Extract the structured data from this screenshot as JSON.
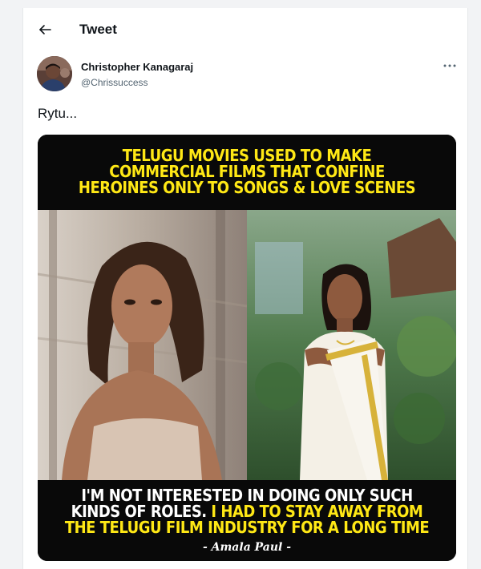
{
  "header": {
    "title": "Tweet"
  },
  "author": {
    "name": "Christopher Kanagaraj",
    "handle": "@Chrissuccess"
  },
  "tweet": {
    "text": "Rytu..."
  },
  "media": {
    "caption_top": [
      "TELUGU MOVIES USED TO MAKE",
      "COMMERCIAL FILMS THAT CONFINE",
      "HEROINES ONLY TO SONGS & LOVE SCENES"
    ],
    "caption_bottom": {
      "line1": "I'M NOT INTERESTED IN DOING ONLY SUCH",
      "line2_white": "KINDS OF ROLES.",
      "line2_yellow": "I HAD TO STAY AWAY FROM",
      "line3": "THE TELUGU FILM INDUSTRY FOR A LONG TIME"
    },
    "credit": "- Amala Paul -"
  },
  "colors": {
    "caption_yellow": "#ffe815",
    "caption_white": "#ffffff",
    "text_primary": "#0f1419",
    "text_secondary": "#536471"
  },
  "icons": {
    "back": "back-arrow-icon",
    "more": "more-options-icon"
  }
}
